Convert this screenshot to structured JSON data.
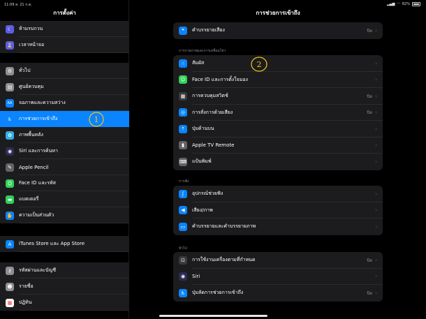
{
  "status_bar": {
    "time": "11:09",
    "date": "ส. 21 ก.ค.",
    "battery": "82%"
  },
  "sidebar": {
    "title": "การตั้งค่า",
    "group1": [
      {
        "name": "do-not-disturb",
        "label": "ห้ามรบกวน",
        "icon": "moon-icon",
        "color": "#5e5ce6",
        "glyph": "☾"
      },
      {
        "name": "screen-time",
        "label": "เวลาหน้าจอ",
        "icon": "hourglass-icon",
        "color": "#5e5ce6",
        "glyph": "⌛"
      }
    ],
    "group2": [
      {
        "name": "general",
        "label": "ทั่วไป",
        "icon": "gear-icon",
        "color": "#8e8e93",
        "glyph": "⚙"
      },
      {
        "name": "control-center",
        "label": "ศูนย์ควบคุม",
        "icon": "toggles-icon",
        "color": "#8e8e93",
        "glyph": "▤"
      },
      {
        "name": "display-brightness",
        "label": "จอภาพและความสว่าง",
        "icon": "aa-icon",
        "color": "#0a84ff",
        "glyph": "AA"
      },
      {
        "name": "accessibility",
        "label": "การช่วยการเข้าถึง",
        "icon": "accessibility-icon",
        "color": "#0a84ff",
        "glyph": "♿",
        "active": true
      },
      {
        "name": "wallpaper",
        "label": "ภาพพื้นหลัง",
        "icon": "flower-icon",
        "color": "#32ade6",
        "glyph": "✿"
      },
      {
        "name": "siri-search",
        "label": "Siri และการค้นหา",
        "icon": "siri-icon",
        "color": "#2c2c54",
        "glyph": "◉"
      },
      {
        "name": "apple-pencil",
        "label": "Apple Pencil",
        "icon": "pencil-icon",
        "color": "#636366",
        "glyph": "✎"
      },
      {
        "name": "face-id-passcode",
        "label": "Face ID และรหัส",
        "icon": "face-id-icon",
        "color": "#30d158",
        "glyph": "☺"
      },
      {
        "name": "battery",
        "label": "แบตเตอรี่",
        "icon": "battery-icon",
        "color": "#30d158",
        "glyph": "▬"
      },
      {
        "name": "privacy",
        "label": "ความเป็นส่วนตัว",
        "icon": "hand-icon",
        "color": "#0a84ff",
        "glyph": "✋"
      }
    ],
    "group3": [
      {
        "name": "itunes-app-store",
        "label": "iTunes Store และ App Store",
        "icon": "app-store-icon",
        "color": "#0a84ff",
        "glyph": "A"
      }
    ],
    "group4": [
      {
        "name": "passwords-accounts",
        "label": "รหัสผ่านและบัญชี",
        "icon": "key-icon",
        "color": "#8e8e93",
        "glyph": "⚷"
      },
      {
        "name": "contacts",
        "label": "รายชื่อ",
        "icon": "contacts-icon",
        "color": "#8e8e93",
        "glyph": "☻"
      },
      {
        "name": "calendar",
        "label": "ปฏิทิน",
        "icon": "calendar-icon",
        "color": "#ffffff",
        "glyph": "▦"
      }
    ]
  },
  "main": {
    "title": "การช่วยการเข้าถึง",
    "top_group": [
      {
        "name": "audio-descriptions",
        "label": "คำบรรยายเสียง",
        "value": "ปิด",
        "icon": "speech-bubble-icon",
        "color": "#0a84ff",
        "glyph": "❝"
      }
    ],
    "physical_motor": {
      "header": "การกายภาพและการเคลื่อนไหว",
      "items": [
        {
          "name": "touch",
          "label": "สัมผัส",
          "value": "",
          "icon": "hand-pointer-icon",
          "color": "#0a84ff",
          "glyph": "☝"
        },
        {
          "name": "face-id-attention",
          "label": "Face ID และการตั้งใจมอง",
          "value": "",
          "icon": "face-id-icon",
          "color": "#30d158",
          "glyph": "☺"
        },
        {
          "name": "switch-control",
          "label": "การควบคุมสวิตช์",
          "value": "ปิด",
          "icon": "grid-icon",
          "color": "#3a3a3c",
          "glyph": "▦"
        },
        {
          "name": "voice-control",
          "label": "การสั่งการด้วยเสียง",
          "value": "ปิด",
          "icon": "voice-icon",
          "color": "#0a84ff",
          "glyph": "◎"
        },
        {
          "name": "top-button",
          "label": "ปุ่มด้านบน",
          "value": "",
          "icon": "top-button-icon",
          "color": "#0a84ff",
          "glyph": "⇡"
        },
        {
          "name": "apple-tv-remote",
          "label": "Apple TV Remote",
          "value": "",
          "icon": "remote-icon",
          "color": "#636366",
          "glyph": "▮"
        },
        {
          "name": "keyboards",
          "label": "แป้นพิมพ์",
          "value": "",
          "icon": "keyboard-icon",
          "color": "#636366",
          "glyph": "⌨"
        }
      ]
    },
    "hearing": {
      "header": "การฟัง",
      "items": [
        {
          "name": "hearing-devices",
          "label": "อุปกรณ์ช่วยฟัง",
          "value": "",
          "icon": "ear-icon",
          "color": "#0a84ff",
          "glyph": "ʃ"
        },
        {
          "name": "audio-visual",
          "label": "เสียง/ภาพ",
          "value": "",
          "icon": "speaker-icon",
          "color": "#0a84ff",
          "glyph": "◀"
        },
        {
          "name": "subtitles-captioning",
          "label": "คำบรรยายและคำบรรยายภาพ",
          "value": "",
          "icon": "captions-icon",
          "color": "#0a84ff",
          "glyph": "▭"
        }
      ]
    },
    "general": {
      "header": "ทั่วไป",
      "items": [
        {
          "name": "guided-access",
          "label": "การใช้งานเครื่องตามที่กำหนด",
          "value": "ปิด",
          "icon": "lock-icon",
          "color": "#3a3a3c",
          "glyph": "⊡"
        },
        {
          "name": "siri",
          "label": "Siri",
          "value": "",
          "icon": "siri-icon",
          "color": "#2c2c54",
          "glyph": "◉"
        },
        {
          "name": "accessibility-shortcut",
          "label": "ปุ่มลัดการช่วยการเข้าถึง",
          "value": "ปิด",
          "icon": "accessibility-icon",
          "color": "#0a84ff",
          "glyph": "♿"
        }
      ]
    }
  },
  "annotations": {
    "circle1": "1",
    "circle2": "2",
    "color": "#f5c518"
  }
}
